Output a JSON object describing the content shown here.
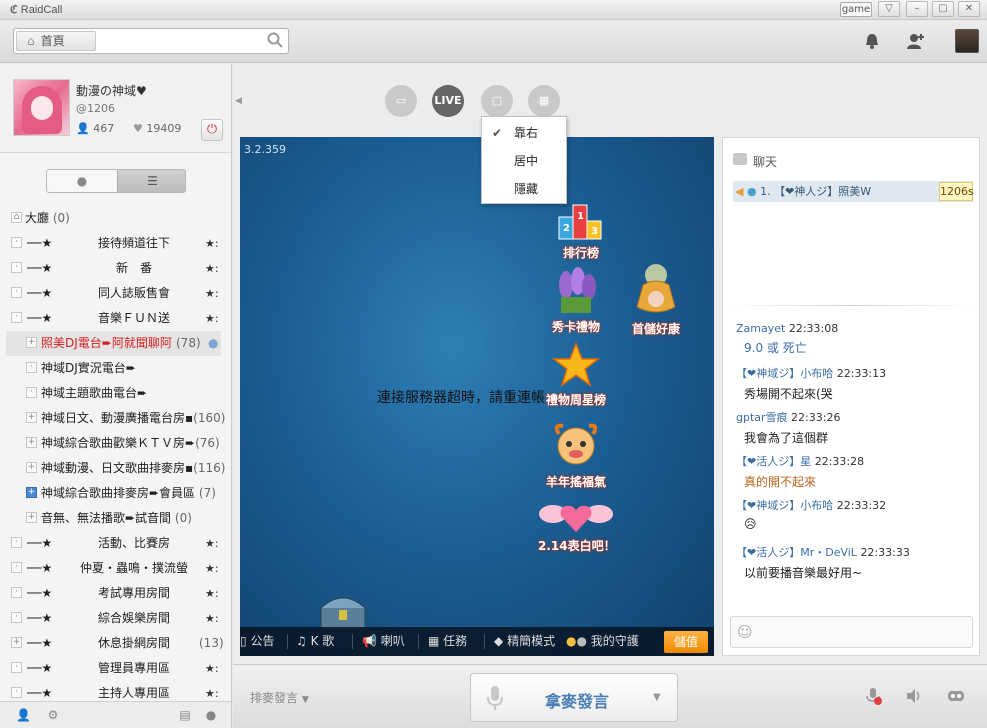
{
  "window": {
    "app_name": "RaidCall",
    "game_tag": "game"
  },
  "toolbar": {
    "home_label": "首頁",
    "search_value": ""
  },
  "profile": {
    "name": "動漫の神域♥",
    "id": "@1206",
    "members": "467",
    "likes": "19409"
  },
  "tree": {
    "root": {
      "label": "大廳",
      "count": "(0)"
    },
    "items": [
      {
        "dash": "──★",
        "label": "接待頻道往下",
        "star": "★:"
      },
      {
        "dash": "──★",
        "label": "新　番",
        "star": "★:"
      },
      {
        "dash": "──★",
        "label": "同人誌販售會",
        "star": "★:"
      },
      {
        "dash": "──★",
        "label": "音樂ＦＵＮ送",
        "star": "★:"
      },
      {
        "label": "照美DJ電台➨阿就聞聊阿",
        "count": "(78)"
      },
      {
        "label": "神域DJ實況電台➨"
      },
      {
        "label": "神域主題歌曲電台➨"
      },
      {
        "label": "神域日文、動漫廣播電台房▪",
        "count": "(160)"
      },
      {
        "label": "神域綜合歌曲歡樂ＫＴＶ房➨",
        "count": "(76)"
      },
      {
        "label": "神域動漫、日文歌曲排麥房▪",
        "count": "(116)"
      },
      {
        "label": "神域綜合歌曲排麥房➨會員區",
        "count": "(7)"
      },
      {
        "label": "音無、無法播歌➨試音間",
        "count": "(0)"
      },
      {
        "dash": "──★",
        "label": "活動、比賽房",
        "star": "★:"
      },
      {
        "dash": "──★",
        "label": "仲夏・蟲鳴・撲流螢",
        "star": "★:"
      },
      {
        "dash": "──★",
        "label": "考試專用房間",
        "star": "★:"
      },
      {
        "dash": "──★",
        "label": "綜合娛樂房間",
        "star": "★:"
      },
      {
        "dash": "──★",
        "label": "休息掛網房間",
        "count": "(13)"
      },
      {
        "dash": "──★",
        "label": "管理員專用區",
        "star": "★:"
      },
      {
        "dash": "──★",
        "label": "主持人專用區",
        "star": "★:"
      }
    ]
  },
  "center": {
    "live_label": "LIVE",
    "version": "3.2.359",
    "connection_message": "連接服務器超時，請重連帳",
    "features": [
      {
        "label": "排行榜"
      },
      {
        "label": "秀卡禮物"
      },
      {
        "label": "首儲好康"
      },
      {
        "label": "禮物周星榜"
      },
      {
        "label": "羊年搖福氣"
      },
      {
        "label": "2.14表白吧！"
      }
    ],
    "video_bar": {
      "announce": "公告",
      "ksong": "K 歌",
      "speaker": "喇叭",
      "task": "任務",
      "simple_mode": "精簡模式",
      "guard": "我的守護",
      "store": "儲值"
    }
  },
  "dropdown": {
    "items": [
      {
        "label": "靠右",
        "checked": true
      },
      {
        "label": "居中",
        "checked": false
      },
      {
        "label": "隱藏",
        "checked": false
      }
    ]
  },
  "chat": {
    "title": "聊天",
    "rank_entry": "1. 【❤神人ジ】照美W",
    "rank_badge": "1206s",
    "messages": [
      {
        "who": "Zamayet",
        "time": "22:33:08",
        "text": "9.0 或 死亡",
        "text_color": "#3a6ea5"
      },
      {
        "who": "【❤神域ジ】小布哈",
        "time": "22:33:13",
        "text": "秀場開不起來(哭",
        "text_color": "#222222"
      },
      {
        "who": "gptar雪痕",
        "time": "22:33:26",
        "text": "我會為了這個群",
        "text_color": "#222222"
      },
      {
        "who": "【❤活人ジ】星",
        "time": "22:33:28",
        "text": "真的開不起來",
        "text_color": "#b5651d"
      },
      {
        "who": "【❤神域ジ】小布哈",
        "time": "22:33:32",
        "text": "😥",
        "text_color": "#222222"
      },
      {
        "who": "【❤活人ジ】Mr・DeViL",
        "time": "22:33:33",
        "text": "以前要播音樂最好用~",
        "text_color": "#222222"
      }
    ]
  },
  "bottom": {
    "queue_label": "排麥發言",
    "mic_label": "拿麥發言"
  }
}
